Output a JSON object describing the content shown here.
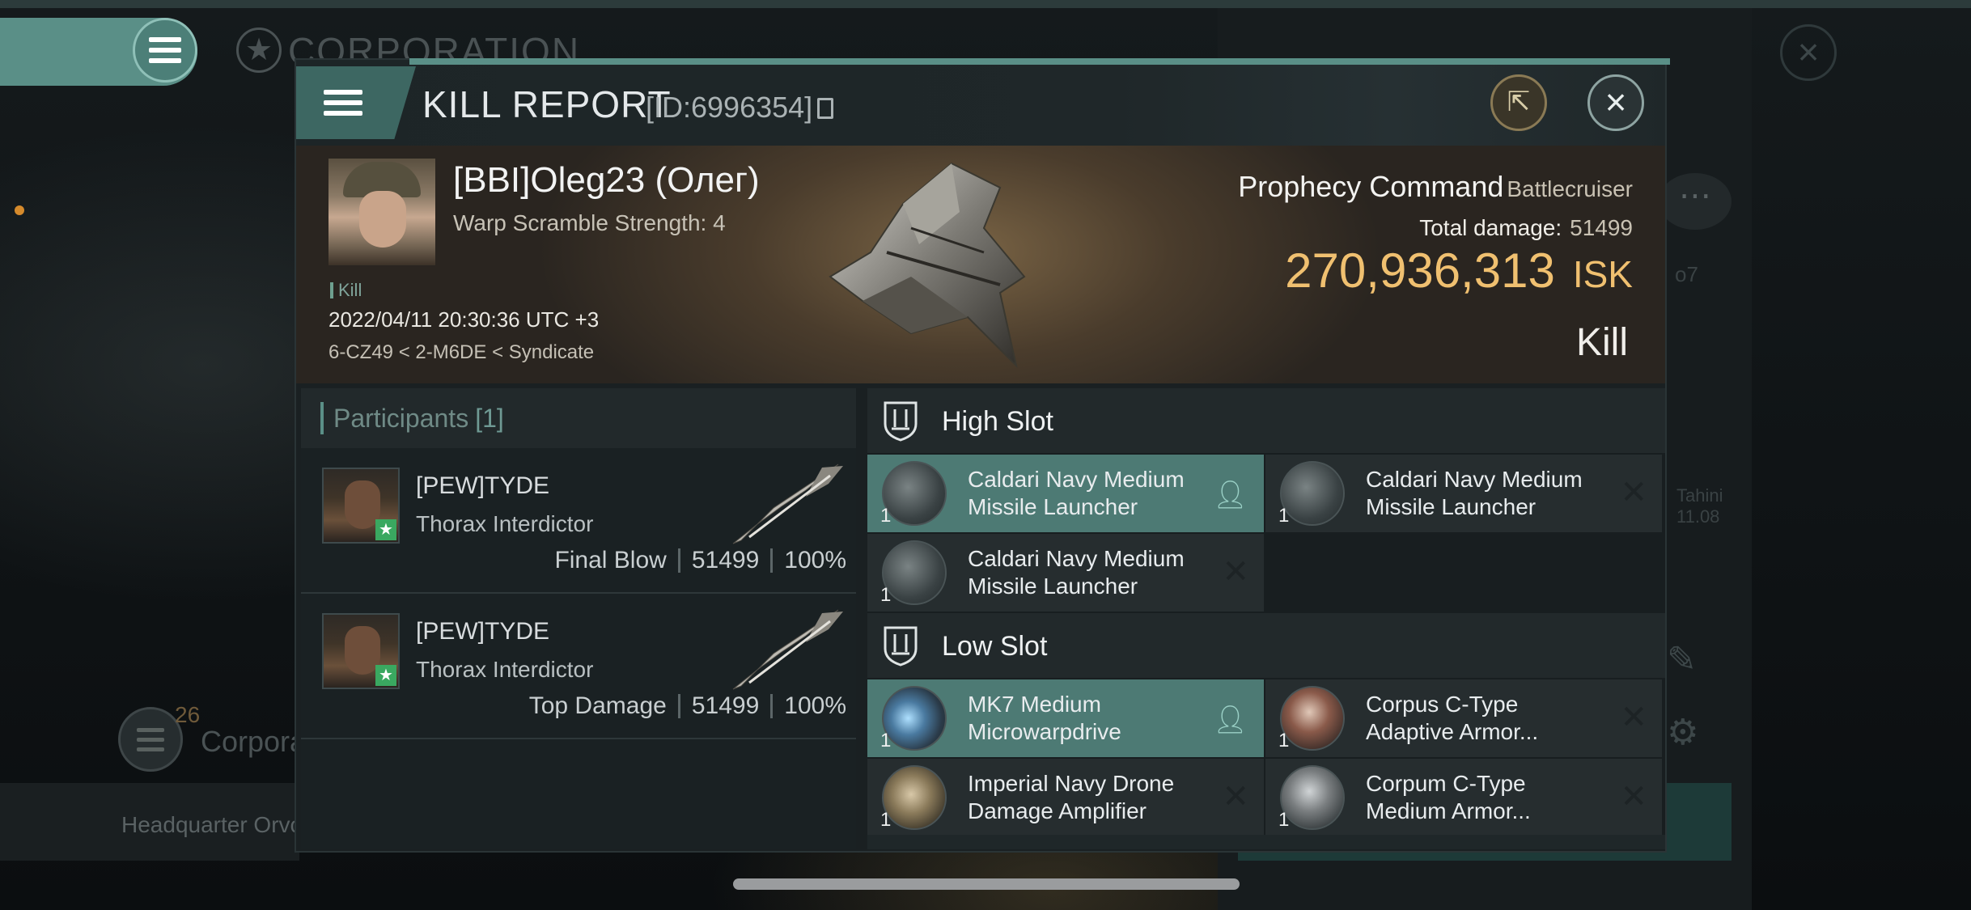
{
  "background": {
    "corp_title": "CORPORATION",
    "corp_badge_number": "26",
    "corp_label": "Corpora",
    "headquarter_text": "Headquarter Orvo",
    "right_text_1": "o7",
    "right_text_2a": "Tahini",
    "right_text_2b": "11.08"
  },
  "dialog": {
    "title": "KILL REPORT",
    "id_text": "[ID:6996354]"
  },
  "victim": {
    "name": "[BBI]Oleg23 (Олег)",
    "warp_scramble": "Warp Scramble Strength: 4",
    "kill_tag": "Kill",
    "datetime": "2022/04/11 20:30:36 UTC +3",
    "location": "6-CZ49 < 2-M6DE < Syndicate",
    "ship_name": "Prophecy Command",
    "ship_class": "Battlecruiser",
    "total_damage_label": "Total damage:",
    "total_damage_value": "51499",
    "isk_value": "270,936,313",
    "isk_unit": "ISK",
    "result": "Kill"
  },
  "participants": {
    "header_label": "Participants",
    "header_count": "[1]",
    "rows": [
      {
        "name": "[PEW]TYDE",
        "ship": "Thorax Interdictor",
        "role": "Final Blow",
        "damage": "51499",
        "percent": "100%"
      },
      {
        "name": "[PEW]TYDE",
        "ship": "Thorax Interdictor",
        "role": "Top Damage",
        "damage": "51499",
        "percent": "100%"
      }
    ]
  },
  "fitting": {
    "high_slot_title": "High Slot",
    "low_slot_title": "Low Slot",
    "high": [
      {
        "name_line1": "Caldari Navy Medium",
        "name_line2": "Missile Launcher",
        "qty": "1",
        "state": "dropped"
      },
      {
        "name_line1": "Caldari Navy Medium",
        "name_line2": "Missile Launcher",
        "qty": "1",
        "state": "destroyed"
      },
      {
        "name_line1": "Caldari Navy Medium",
        "name_line2": "Missile Launcher",
        "qty": "1",
        "state": "destroyed"
      }
    ],
    "low": [
      {
        "name_line1": "MK7 Medium",
        "name_line2": "Microwarpdrive",
        "qty": "1",
        "state": "dropped"
      },
      {
        "name_line1": "Corpus C-Type",
        "name_line2": "Adaptive Armor...",
        "qty": "1",
        "state": "destroyed"
      },
      {
        "name_line1": "Imperial Navy Drone",
        "name_line2": "Damage Amplifier",
        "qty": "1",
        "state": "destroyed"
      },
      {
        "name_line1": "Corpum C-Type",
        "name_line2": "Medium Armor...",
        "qty": "1",
        "state": "destroyed"
      }
    ]
  },
  "icons": {
    "menu": "hamburger-icon",
    "close": "close-icon",
    "share": "share-icon",
    "copy": "copy-icon",
    "slot": "slot-shield-icon",
    "dropped": "person-icon",
    "destroyed": "x-icon"
  },
  "colors": {
    "accent_teal": "#5a8f87",
    "isk_gold": "#f0c070",
    "active_row": "#4d7a74"
  }
}
